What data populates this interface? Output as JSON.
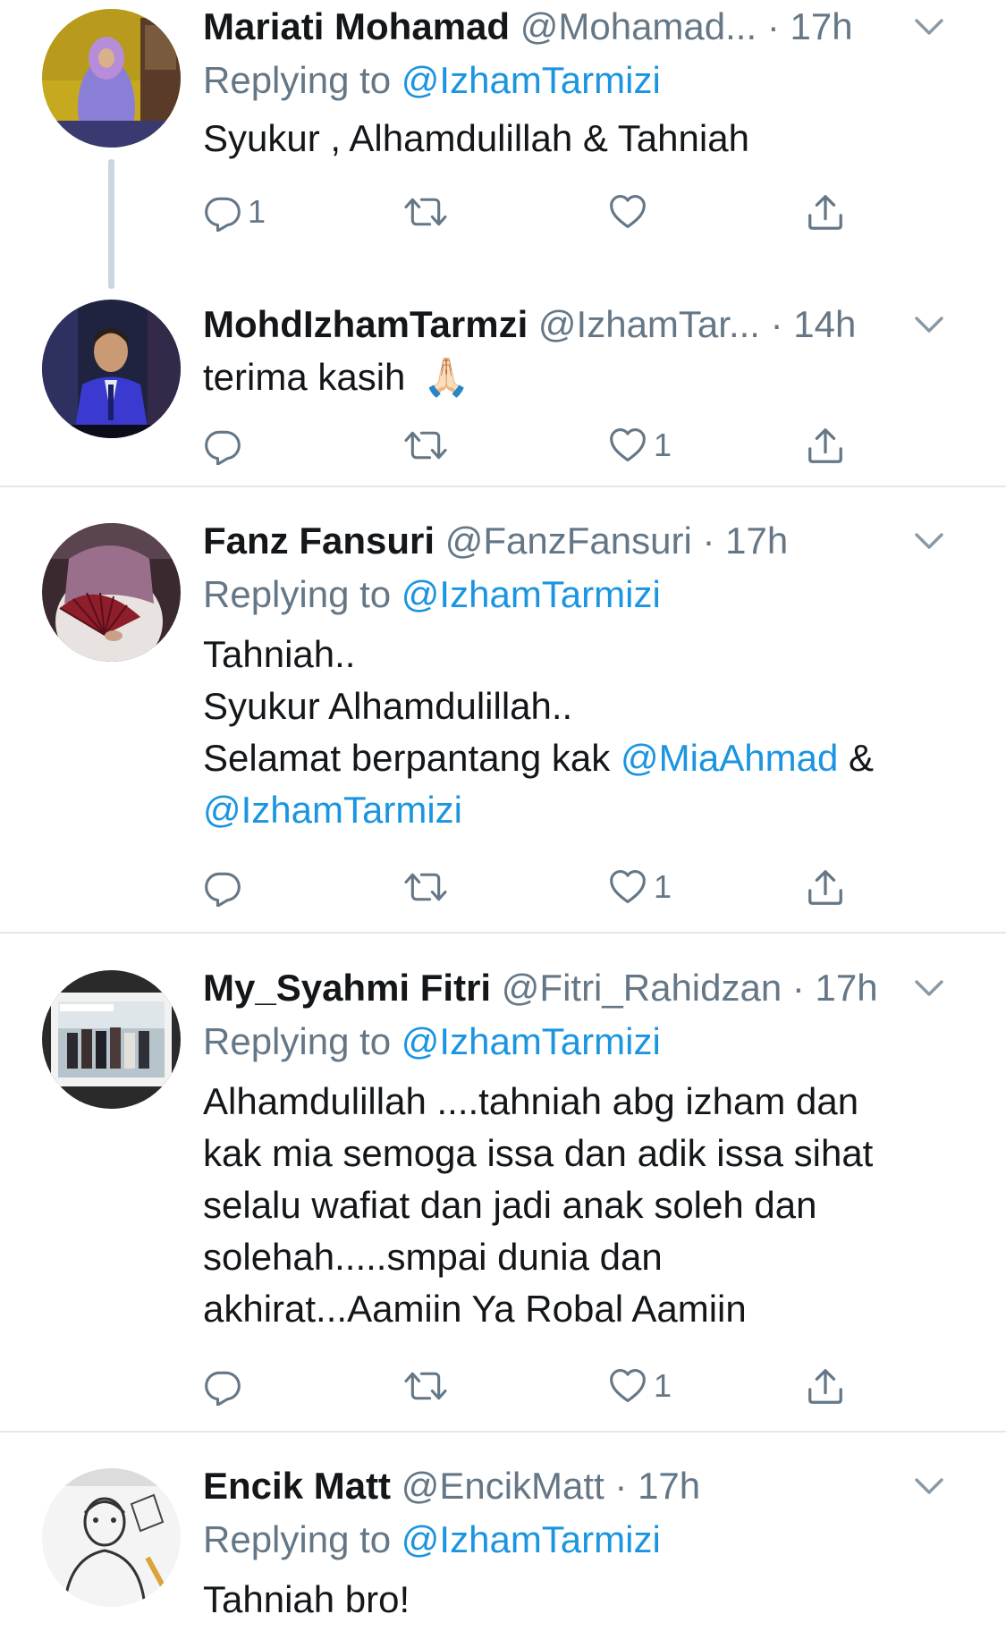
{
  "tweets": [
    {
      "name": "Mariati Mohamad",
      "handle": "@Mohamad...",
      "time": "17h",
      "replying_prefix": "Replying to ",
      "replying_to": "@IzhamTarmizi",
      "text": "Syukur , Alhamdulillah & Tahniah",
      "replies": "1",
      "retweets": "",
      "likes": ""
    },
    {
      "name": "MohdIzhamTarmzi",
      "handle": "@IzhamTar...",
      "time": "14h",
      "text": "terima kasih",
      "emoji": "🙏🏻",
      "replies": "",
      "retweets": "",
      "likes": "1"
    },
    {
      "name": "Fanz Fansuri",
      "handle": "@FanzFansuri",
      "time": "17h",
      "replying_prefix": "Replying to ",
      "replying_to": "@IzhamTarmizi",
      "text_line1": "Tahniah..",
      "text_line2": "Syukur Alhamdulillah..",
      "text_line3": "Selamat berpantang kak ",
      "mention1": "@MiaAhmad",
      "amp": " &",
      "mention2": "@IzhamTarmizi",
      "replies": "",
      "retweets": "",
      "likes": "1"
    },
    {
      "name": "My_Syahmi Fitri",
      "handle": "@Fitri_Rahidzan",
      "time": "17h",
      "replying_prefix": "Replying to ",
      "replying_to": "@IzhamTarmizi",
      "text_lines": [
        "Alhamdulillah ....tahniah abg izham dan",
        "kak mia semoga issa dan adik issa sihat",
        "selalu wafiat dan jadi anak soleh dan",
        "solehah.....smpai dunia dan",
        "akhirat...Aamiin Ya Robal Aamiin"
      ],
      "replies": "",
      "retweets": "",
      "likes": "1"
    },
    {
      "name": "Encik Matt",
      "handle": "@EncikMatt",
      "time": "17h",
      "replying_prefix": "Replying to ",
      "replying_to": "@IzhamTarmizi",
      "text": "Tahniah bro!"
    }
  ],
  "separator": " · ",
  "colors": {
    "text": "#14171a",
    "secondary": "#657786",
    "link": "#1b95e0",
    "divider": "#e1e8ed"
  },
  "icons": [
    "reply-icon",
    "retweet-icon",
    "like-icon",
    "share-icon",
    "chevron-down-icon"
  ]
}
